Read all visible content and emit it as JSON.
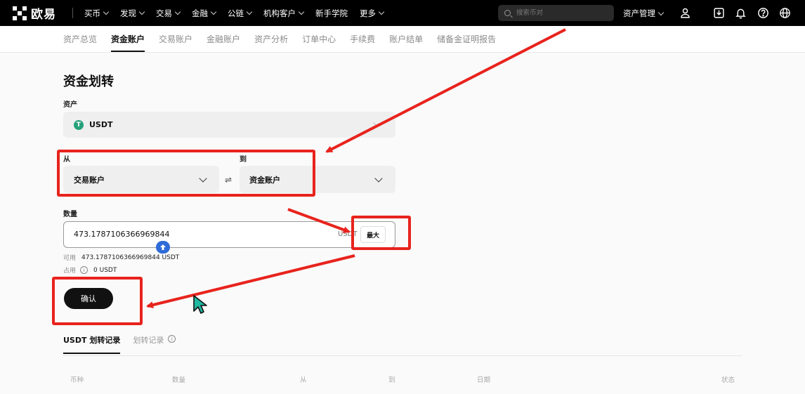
{
  "topbar": {
    "logo": "欧易",
    "nav": [
      "买币",
      "发现",
      "交易",
      "金融",
      "公链",
      "机构客户",
      "新手学院",
      "更多"
    ],
    "nav_has_caret": [
      true,
      true,
      true,
      true,
      true,
      true,
      false,
      true
    ],
    "search_placeholder": "搜索币对",
    "asset_mgmt": "资产管理",
    "icons": [
      "user-icon",
      "download-icon",
      "bell-icon",
      "help-icon",
      "globe-icon"
    ]
  },
  "subnav": {
    "tabs": [
      "资产总览",
      "资金账户",
      "交易账户",
      "金融账户",
      "资产分析",
      "订单中心",
      "手续费",
      "账户结单",
      "储备金证明报告"
    ],
    "active_index": 1
  },
  "transfer": {
    "title": "资金划转",
    "asset_label": "资产",
    "asset_value": "USDT",
    "asset_icon": "tether-icon",
    "from_label": "从",
    "from_value": "交易账户",
    "to_label": "到",
    "to_value": "资金账户",
    "swap_icon": "⇌",
    "amount_label": "数量",
    "amount_value": "473.1787106366969844",
    "amount_unit": "USDT",
    "max_label": "最大",
    "available_label": "可用",
    "available_value": "473.1787106366969844 USDT",
    "occupied_label": "占用",
    "occupied_value": "0 USDT",
    "confirm_label": "确认"
  },
  "records": {
    "tabs": [
      "USDT 划转记录",
      "划转记录"
    ],
    "active_index": 0,
    "columns": [
      "币种",
      "数量",
      "从",
      "到",
      "日期",
      "状态"
    ]
  },
  "colors": {
    "annotation": "#e8231d",
    "usdt": "#26a17b",
    "cursor": "#2e6bd9"
  }
}
